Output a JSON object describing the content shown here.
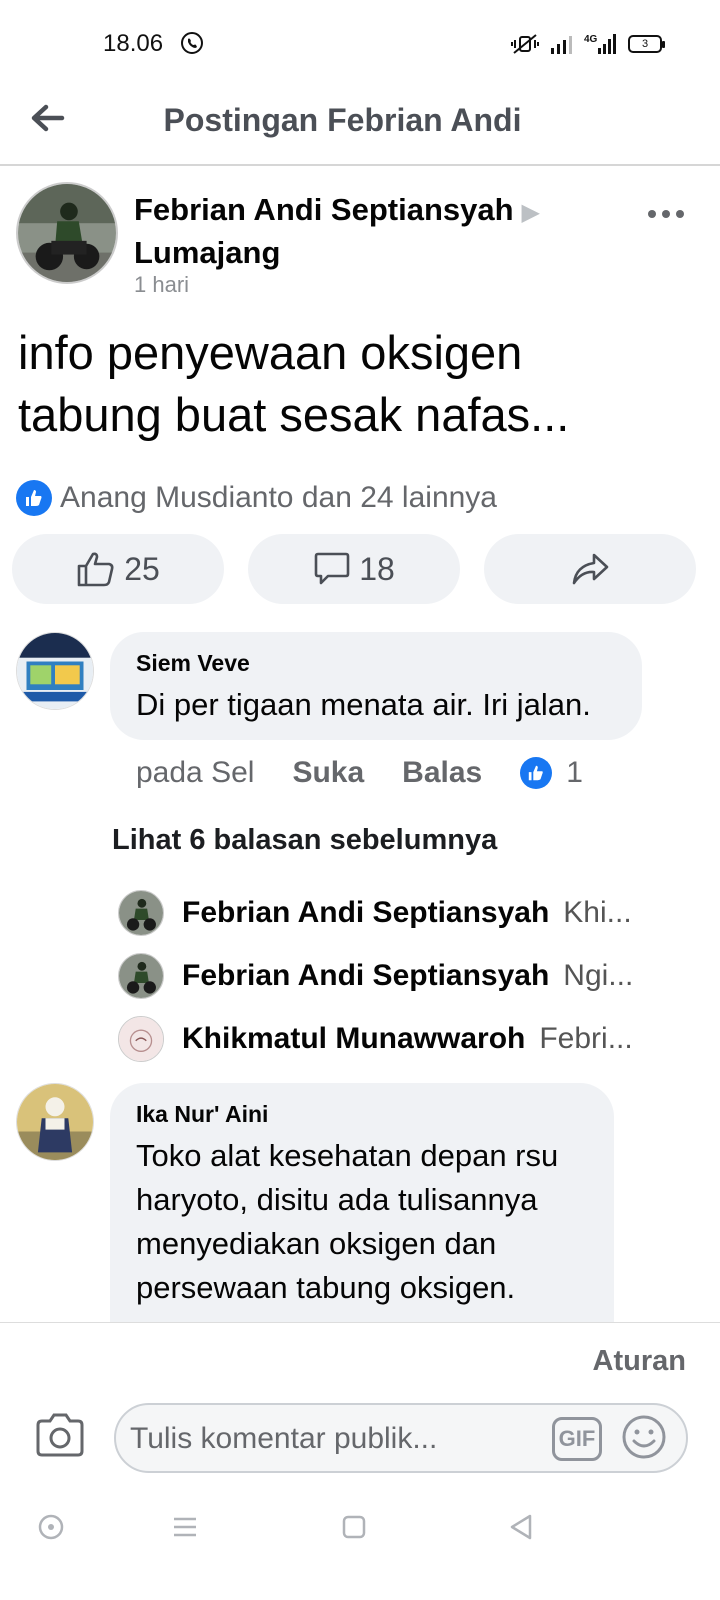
{
  "status_bar": {
    "time": "18.06",
    "battery_level": "3"
  },
  "header": {
    "title": "Postingan Febrian Andi"
  },
  "post": {
    "author_name": "Febrian Andi Septiansyah",
    "group_name": "Lumajang",
    "time": "1 hari",
    "text_line1": "info penyewaan oksigen",
    "text_line2": "tabung buat sesak nafas..."
  },
  "reactions": {
    "summary": "Anang Musdianto dan 24 lainnya",
    "like_count": "25",
    "comment_count": "18"
  },
  "comments": [
    {
      "name": "Siem Veve",
      "text": "Di per tigaan menata air. Iri jalan.",
      "time": "pada Sel",
      "like_label": "Suka",
      "reply_label": "Balas",
      "reaction_count": "1",
      "see_previous": "Lihat 6 balasan sebelumnya",
      "replies": [
        {
          "name": "Febrian Andi Septiansyah",
          "text": "Khi..."
        },
        {
          "name": "Febrian Andi Septiansyah",
          "text": "Ngi..."
        },
        {
          "name": "Khikmatul Munawwaroh",
          "text": "Febri..."
        }
      ]
    },
    {
      "name": "Ika Nur' Aini",
      "text_lines": [
        "Toko alat kesehatan depan rsu",
        "haryoto, disitu ada tulisannya",
        "menyediakan oksigen dan",
        "persewaan tabung oksigen."
      ]
    }
  ],
  "composer": {
    "rules_label": "Aturan",
    "placeholder": "Tulis komentar publik...",
    "gif_label": "GIF"
  },
  "colors": {
    "accent": "#1877f2",
    "bubble": "#f0f2f5",
    "secondary_text": "#65676b"
  }
}
